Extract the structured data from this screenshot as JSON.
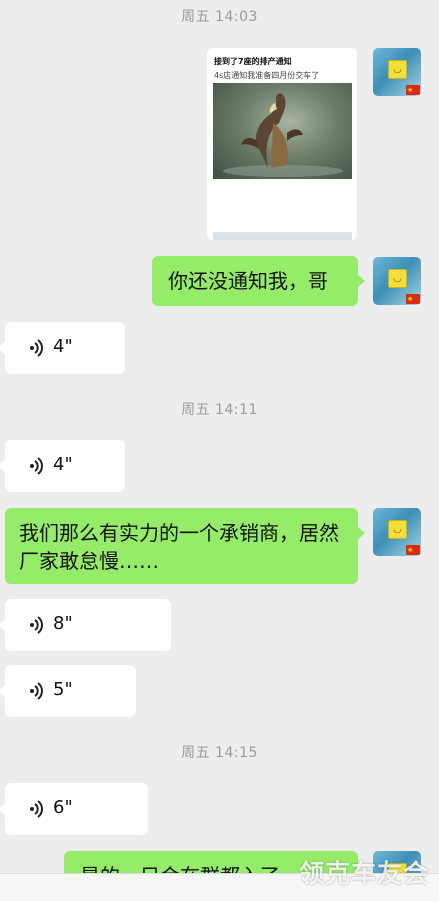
{
  "messages": {
    "ts1": "周五 14:03",
    "ts2": "周五 14:11",
    "ts3": "周五 14:15",
    "card_title": "接到了7座的排产通知",
    "card_subtitle": "4s店通知我准备四月份交车了",
    "msg_1": "你还没通知我，哥",
    "msg_2": "我们那么有实力的一个承销商，居然厂家敢怠慢……",
    "msg_3_partial": "是的，只会在群都入了",
    "voice_1": "4\"",
    "voice_2": "4\"",
    "voice_3": "8\"",
    "voice_4": "5\"",
    "voice_5": "6\""
  },
  "watermark": "领克车友会",
  "colors": {
    "background": "#ededed",
    "sent_bubble": "#95ec69",
    "received_bubble": "#ffffff",
    "timestamp": "#9a9a9a"
  },
  "icons": [
    "voice-wave-icon",
    "avatar",
    "china-flag-badge"
  ]
}
